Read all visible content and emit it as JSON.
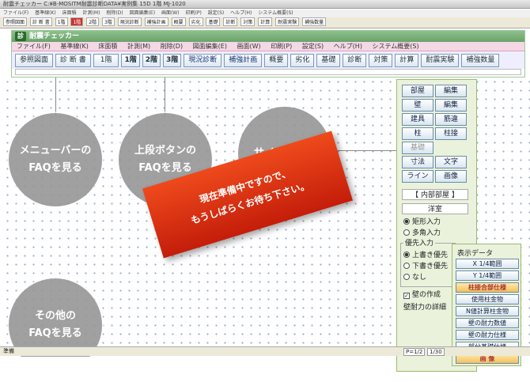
{
  "bg_window": {
    "title": "耐震チェッカー  C:¥B-MOSITM耐震診断DATA¥実例集 15D  1階 MJ-1020",
    "menu": [
      "ファイル(F)",
      "基準線(K)",
      "床面積",
      "計測(M)",
      "削除(D)",
      "図面編集(E)",
      "画面(W)",
      "印刷(P)",
      "設定(S)",
      "ヘルプ(H)",
      "システム概要(S)"
    ],
    "toolbar": [
      "参照図面",
      "診 断 書",
      "1階",
      "1階",
      "2階",
      "3階",
      "現況診断",
      "補強計画",
      "概要",
      "劣化",
      "基礎",
      "診断",
      "対策",
      "計算",
      "耐震実験",
      "補強数量"
    ]
  },
  "window": {
    "title": "耐震チェッカー",
    "logo": "診",
    "menu": [
      "ファイル(F)",
      "基準線(K)",
      "床面積",
      "計測(M)",
      "削除(D)",
      "図面編集(E)",
      "画面(W)",
      "印刷(P)",
      "設定(S)",
      "ヘルプ(H)",
      "システム概要(S)"
    ],
    "tools": {
      "ref": "参照図面",
      "diag": "診 断 書",
      "floor_select": "1階",
      "floor1": "1階",
      "floor2": "2階",
      "floor3": "3階",
      "current": "現況診断",
      "reinforce": "補強計画",
      "summary": "概要",
      "deterioration": "劣化",
      "foundation": "基礎",
      "diagnosis": "診断",
      "measures": "対策",
      "calc": "計算",
      "experiment": "耐震実験",
      "quantity": "補強数量"
    }
  },
  "circles": {
    "menu": [
      "メニューバーの",
      "FAQを見る"
    ],
    "top": [
      "上段ボタンの",
      "FAQを見る"
    ],
    "side": [
      "サイドバーの",
      ""
    ],
    "other": [
      "その他の",
      "FAQを見る"
    ]
  },
  "banner": [
    "現在準備中ですので、",
    "もうしばらくお待ち下さい。"
  ],
  "side": {
    "room": "部屋",
    "edit1": "編集",
    "wall": "壁",
    "edit2": "編集",
    "fitting": "建具",
    "brace": "筋違",
    "column": "柱",
    "joint": "柱接",
    "foundation": "基礎",
    "dimension": "寸法",
    "text": "文字",
    "line": "ライン",
    "image": "画像",
    "interior_room": "【 内部部屋 】",
    "room_name": "洋室",
    "rect_input": "矩形入力",
    "poly_input": "多角入力",
    "priority_title": "優先入力",
    "over_top": "上書き優先",
    "under_priority": "下書き優先",
    "none": "なし",
    "wall_create": "壁の作成",
    "wall_detail": "壁耐力の詳細"
  },
  "display": {
    "title": "表示データ",
    "items": [
      "X 1/4範囲",
      "Y 1/4範囲",
      "柱接合部仕様",
      "使用柱金物",
      "N値計算柱金物",
      "壁の耐力数値",
      "壁の耐力仕様",
      "部分基礎仕様",
      "画 像"
    ]
  },
  "status": {
    "left": "準備",
    "page": "P=1/2",
    "scale": "1/30"
  }
}
